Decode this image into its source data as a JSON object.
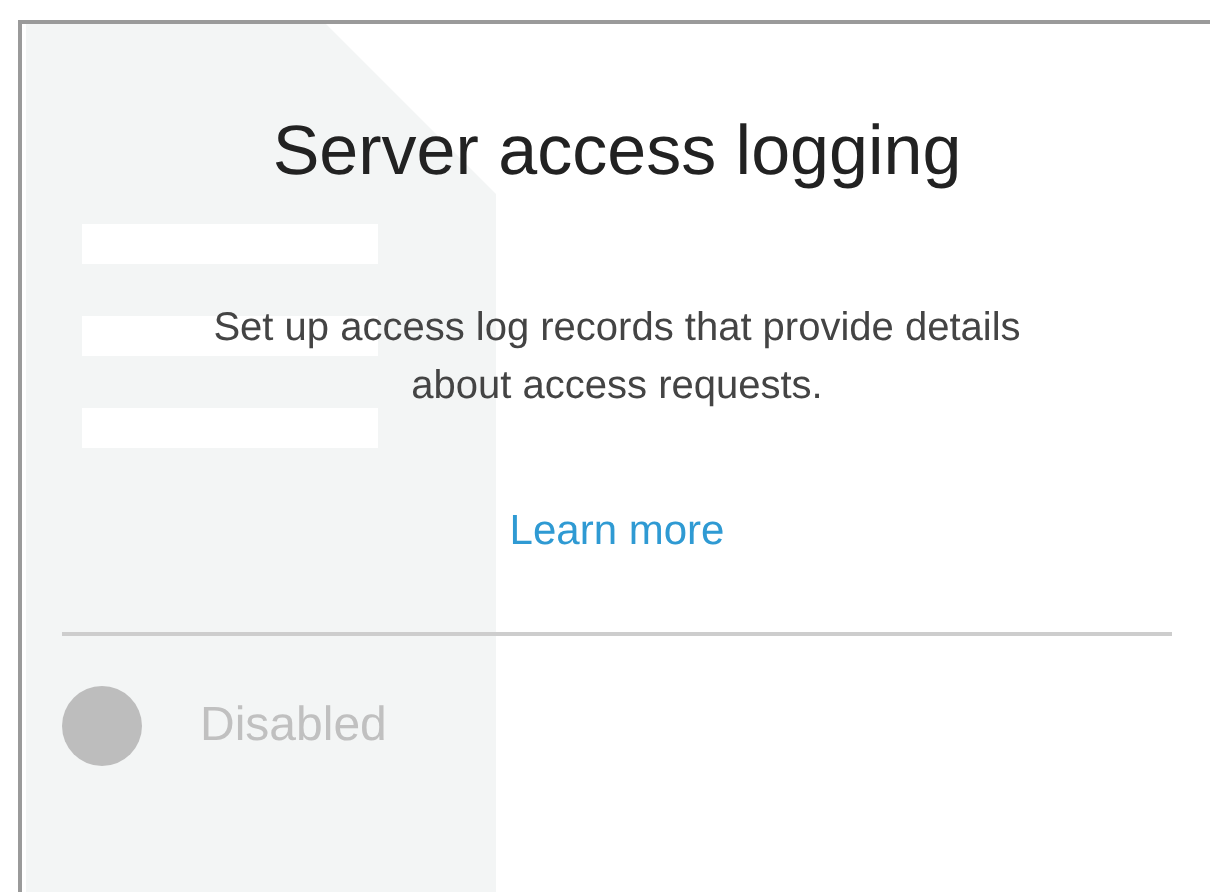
{
  "card": {
    "title": "Server access logging",
    "description": "Set up access log records that provide details about access requests.",
    "link": "Learn more",
    "status": {
      "label": "Disabled",
      "enabled": false
    }
  }
}
